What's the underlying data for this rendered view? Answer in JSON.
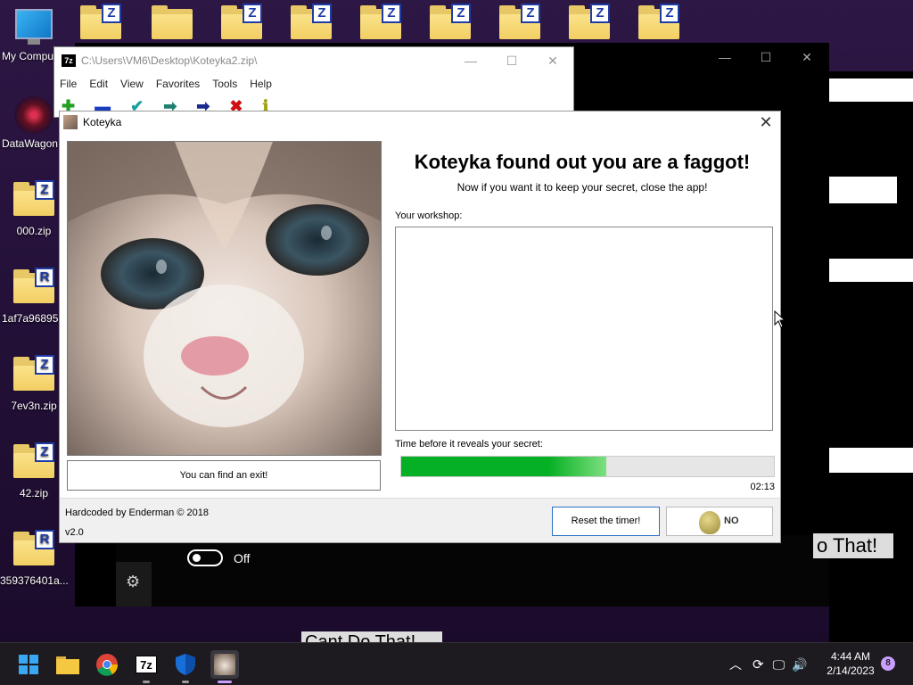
{
  "desktop": {
    "icons": [
      {
        "label": "My Computer",
        "type": "computer"
      },
      {
        "label": "DataWagon",
        "type": "app"
      },
      {
        "label": "000.zip",
        "badge": "Z"
      },
      {
        "label": "1af7a96895",
        "badge": "R"
      },
      {
        "label": "7ev3n.zip",
        "badge": "Z"
      },
      {
        "label": "42.zip",
        "badge": "Z"
      },
      {
        "label": "359376401a...",
        "badge": "R"
      }
    ],
    "top_badges": [
      "Z",
      "",
      "Z",
      "Z",
      "Z",
      "Z",
      "Z",
      "Z",
      "Z"
    ]
  },
  "sevenzip": {
    "title": "C:\\Users\\VM6\\Desktop\\Koteyka2.zip\\",
    "logo": "7z",
    "menu": [
      "File",
      "Edit",
      "View",
      "Favorites",
      "Tools",
      "Help"
    ]
  },
  "background_text": {
    "do_that": "o That!",
    "cant_do_that": "Cant Do That!",
    "toggle_label": "Off"
  },
  "dialog": {
    "title": "Koteyka",
    "headline": "Koteyka found out you are a faggot!",
    "subline": "Now if you want it to keep your secret, close the app!",
    "workshop_label": "Your workshop:",
    "timer_label": "Time before it reveals your secret:",
    "progress": 0.55,
    "time_left": "02:13",
    "exit_button": "You can find an exit!",
    "footer_credit": "Hardcoded by Enderman © 2018",
    "version": "v2.0",
    "reset_button": "Reset the timer!",
    "baldi_text": "NO"
  },
  "taskbar": {
    "time": "4:44 AM",
    "date": "2/14/2023",
    "notifications": "8"
  },
  "colors": {
    "progress_green": "#06b025",
    "badge_blue": "#1f3ca6",
    "folder_yellow": "#f2cf63"
  }
}
